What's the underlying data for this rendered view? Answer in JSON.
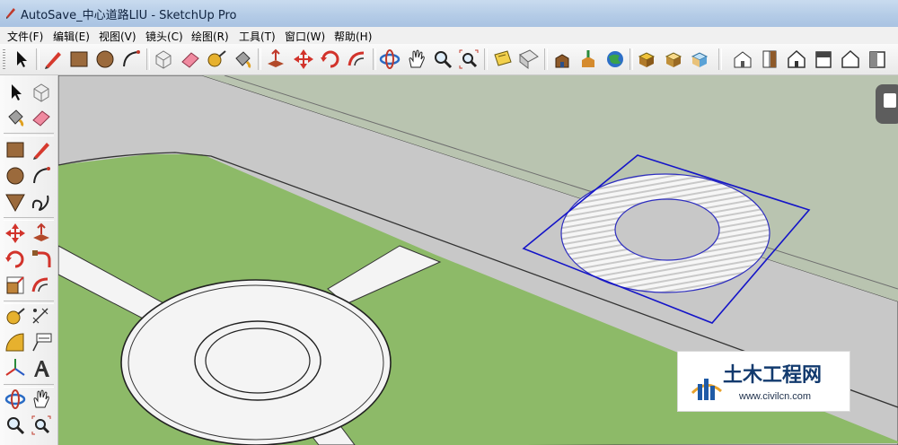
{
  "window": {
    "title": "AutoSave_中心道路LIU - SketchUp Pro"
  },
  "menu": [
    "文件(F)",
    "编辑(E)",
    "视图(V)",
    "镜头(C)",
    "绘图(R)",
    "工具(T)",
    "窗口(W)",
    "帮助(H)"
  ],
  "watermark": {
    "name": "土木工程网",
    "url": "www.civilcn.com"
  }
}
